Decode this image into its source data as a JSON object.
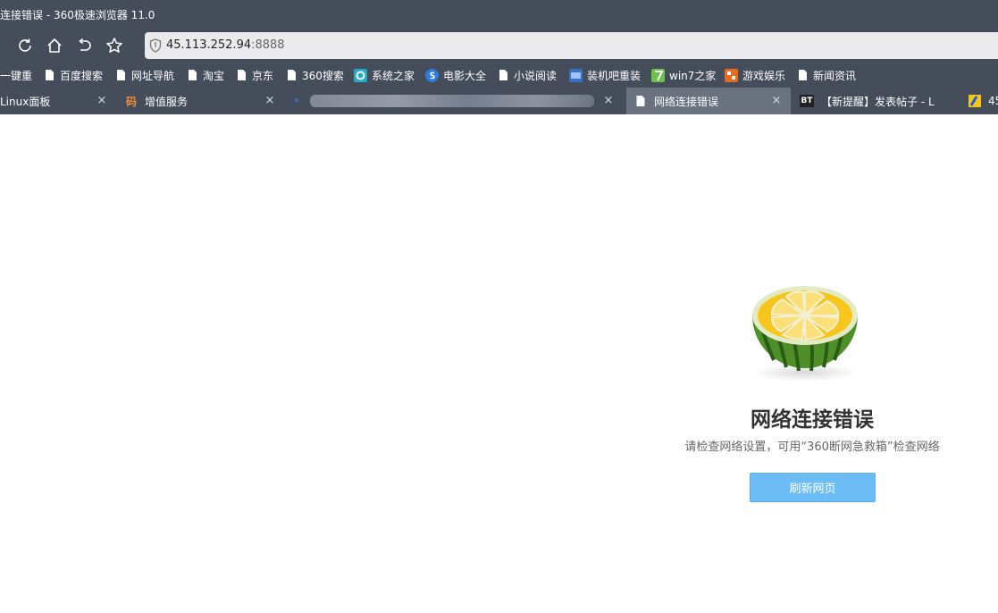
{
  "window": {
    "title": "连接错误 - 360极速浏览器 11.0"
  },
  "address_bar": {
    "host": "45.113.252.94",
    "port": ":8888"
  },
  "bookmarks": [
    {
      "label": "一键重",
      "icon": "page-icon"
    },
    {
      "label": "百度搜索",
      "icon": "page-icon"
    },
    {
      "label": "网址导航",
      "icon": "page-icon"
    },
    {
      "label": "淘宝",
      "icon": "page-icon"
    },
    {
      "label": "京东",
      "icon": "page-icon"
    },
    {
      "label": "360搜索",
      "icon": "page-icon"
    },
    {
      "label": "系统之家",
      "icon": "xitong-icon"
    },
    {
      "label": "电影大全",
      "icon": "sogou-icon"
    },
    {
      "label": "小说阅读",
      "icon": "page-icon"
    },
    {
      "label": "装机吧重装",
      "icon": "zhuangji-icon"
    },
    {
      "label": "win7之家",
      "icon": "win7-icon"
    },
    {
      "label": "游戏娱乐",
      "icon": "game-icon"
    },
    {
      "label": "新闻资讯",
      "icon": "page-icon"
    }
  ],
  "tabs": [
    {
      "label": "Linux面板",
      "close": "×"
    },
    {
      "label": "增值服务",
      "close": "×",
      "favicon_text": "码"
    },
    {
      "label": "",
      "close": "×"
    },
    {
      "label": "网络连接错误",
      "close": "×",
      "active": true
    },
    {
      "label": "【新提醒】发表帖子 - L",
      "favicon_text": "BT"
    },
    {
      "label": "45"
    }
  ],
  "error_page": {
    "title": "网络连接错误",
    "description": "请检查网络设置，可用“360断网急救箱”检查网络",
    "refresh_button": "刷新网页"
  },
  "colors": {
    "chrome_bg": "#454c5a",
    "active_tab_bg": "#6a717f",
    "address_bg": "#ebebed",
    "refresh_button": "#6cbcf5"
  }
}
